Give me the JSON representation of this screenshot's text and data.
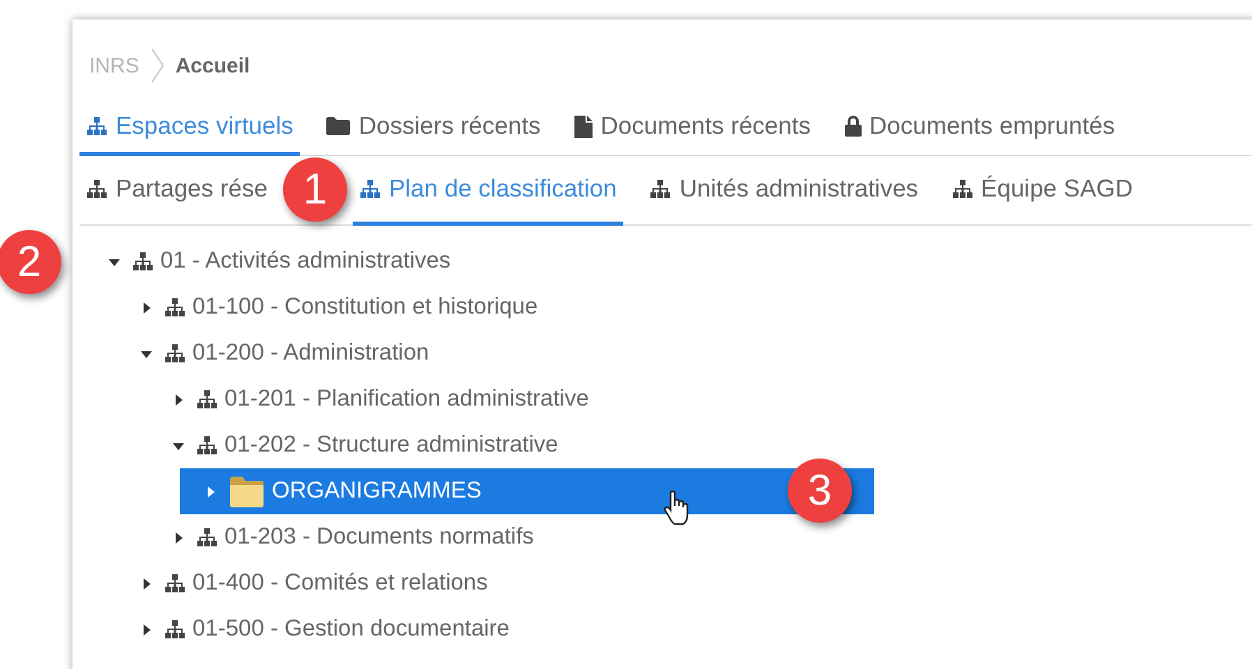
{
  "breadcrumb": [
    {
      "label": "INRS",
      "current": false
    },
    {
      "label": "Accueil",
      "current": true
    }
  ],
  "main_tabs": [
    {
      "label": "Espaces virtuels",
      "kind": "space",
      "selected": true
    },
    {
      "label": "Dossiers récents",
      "kind": "folders",
      "selected": false
    },
    {
      "label": "Documents récents",
      "kind": "documents",
      "selected": false
    },
    {
      "label": "Documents empruntés",
      "kind": "borrowed",
      "selected": false
    }
  ],
  "sub_tabs": [
    {
      "label": "Partages rése",
      "kind": "space",
      "selected": false,
      "badge": "1"
    },
    {
      "label": "Plan de classification",
      "kind": "space",
      "selected": true
    },
    {
      "label": "Unités administratives",
      "kind": "space",
      "selected": false
    },
    {
      "label": "Équipe SAGD",
      "kind": "space",
      "selected": false
    }
  ],
  "tree": [
    {
      "label": "01 - Activités administratives",
      "kind": "group",
      "expanded": true,
      "selected": false,
      "badge": "2",
      "children": [
        {
          "label": "01-100 - Constitution et historique",
          "kind": "group",
          "expanded": false,
          "selected": false
        },
        {
          "label": "01-200 - Administration",
          "kind": "group",
          "expanded": true,
          "selected": false,
          "children": [
            {
              "label": "01-201 - Planification administrative",
              "kind": "group",
              "expanded": false,
              "selected": false
            },
            {
              "label": "01-202 - Structure administrative",
              "kind": "group",
              "expanded": true,
              "selected": false,
              "children": [
                {
                  "label": "ORGANIGRAMMES",
                  "kind": "folder",
                  "expanded": false,
                  "selected": true,
                  "cursor": true,
                  "badge": "3"
                }
              ]
            },
            {
              "label": "01-203 - Documents normatifs",
              "kind": "group",
              "expanded": false,
              "selected": false
            }
          ]
        },
        {
          "label": "01-400 - Comités et relations",
          "kind": "group",
          "expanded": false,
          "selected": false
        },
        {
          "label": "01-500 - Gestion documentaire",
          "kind": "group",
          "expanded": false,
          "selected": false
        }
      ]
    }
  ]
}
